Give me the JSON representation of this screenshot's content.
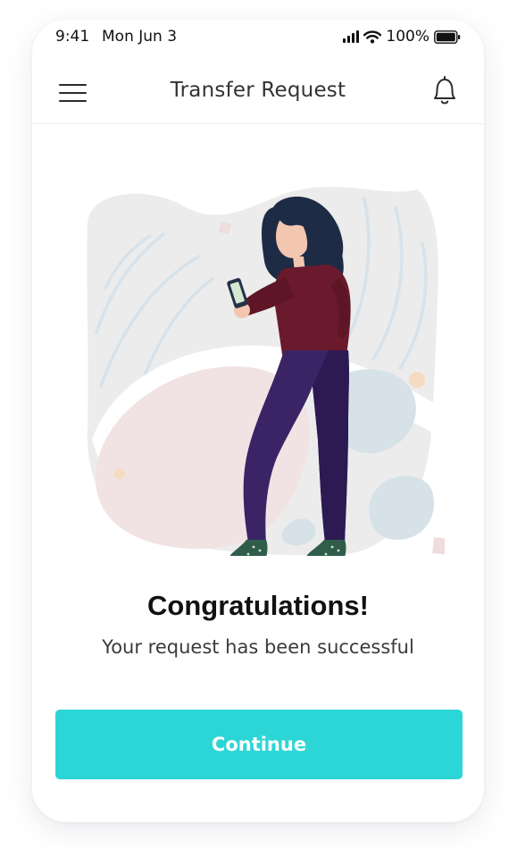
{
  "status_bar": {
    "time": "9:41",
    "date": "Mon Jun 3",
    "battery": "100%",
    "icons": [
      "signal-icon",
      "wifi-icon",
      "battery-icon"
    ]
  },
  "nav": {
    "title": "Transfer Request",
    "left_icon": "menu-icon",
    "right_icon": "bell-icon"
  },
  "content": {
    "headline": "Congratulations!",
    "message": "Your request has been successful"
  },
  "actions": {
    "continue_label": "Continue"
  },
  "colors": {
    "accent": "#2dd6d6",
    "shirt": "#6b1a2e",
    "pants": "#3b2466",
    "hair": "#1e2b45",
    "blob": "#ededed",
    "pink_blob": "#f1e3e3",
    "blue_blob": "#d6e1e8"
  }
}
